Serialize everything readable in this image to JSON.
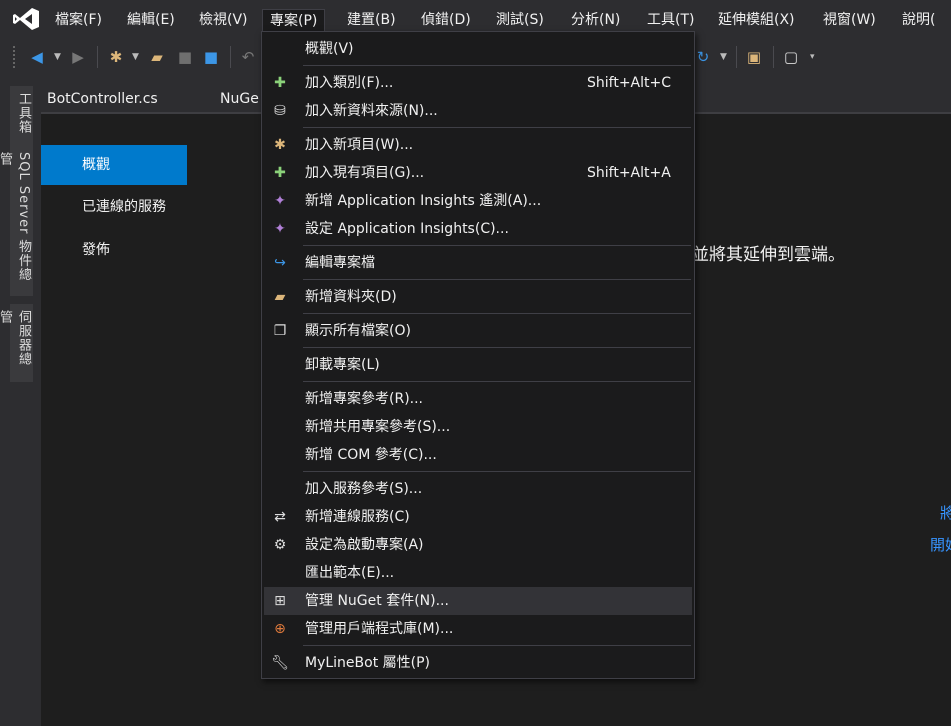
{
  "menubar": {
    "items": [
      "檔案(F)",
      "編輯(E)",
      "檢視(V)",
      "專案(P)",
      "建置(B)",
      "偵錯(D)",
      "測試(S)",
      "分析(N)",
      "工具(T)",
      "延伸模組(X)",
      "視窗(W)",
      "說明("
    ],
    "active_index": 3
  },
  "left_tool_windows": [
    "工具箱",
    "SQL Server 物件總管",
    "伺服器總管"
  ],
  "doc_tabs": [
    "BotController.cs",
    "NuGe"
  ],
  "project_nav": {
    "items": [
      "概觀",
      "已連線的服務",
      "發佈"
    ],
    "selected_index": 0
  },
  "content": {
    "partial_text": "並將其延伸到雲端。",
    "partial_links": [
      "將",
      "開始"
    ]
  },
  "project_menu": {
    "items": [
      {
        "label": "概觀(V)",
        "shortcut": "",
        "icon": ""
      },
      {
        "label": "加入類別(F)...",
        "shortcut": "Shift+Alt+C",
        "icon": "add-class-icon"
      },
      {
        "label": "加入新資料來源(N)...",
        "shortcut": "",
        "icon": "add-datasource-icon"
      },
      {
        "label": "加入新項目(W)...",
        "shortcut": "",
        "icon": "add-new-item-icon"
      },
      {
        "label": "加入現有項目(G)...",
        "shortcut": "Shift+Alt+A",
        "icon": "add-existing-item-icon"
      },
      {
        "label": "新增 Application Insights 遙測(A)...",
        "shortcut": "",
        "icon": "app-insights-icon"
      },
      {
        "label": "設定 Application Insights(C)...",
        "shortcut": "",
        "icon": "app-insights-icon"
      },
      {
        "label": "編輯專案檔",
        "shortcut": "",
        "icon": "edit-project-icon"
      },
      {
        "label": "新增資料夾(D)",
        "shortcut": "",
        "icon": "new-folder-icon"
      },
      {
        "label": "顯示所有檔案(O)",
        "shortcut": "",
        "icon": "show-all-files-icon"
      },
      {
        "label": "卸載專案(L)",
        "shortcut": "",
        "icon": ""
      },
      {
        "label": "新增專案參考(R)...",
        "shortcut": "",
        "icon": ""
      },
      {
        "label": "新增共用專案參考(S)...",
        "shortcut": "",
        "icon": ""
      },
      {
        "label": "新增 COM 參考(C)...",
        "shortcut": "",
        "icon": ""
      },
      {
        "label": "加入服務參考(S)...",
        "shortcut": "",
        "icon": ""
      },
      {
        "label": "新增連線服務(C)",
        "shortcut": "",
        "icon": "connected-service-icon"
      },
      {
        "label": "設定為啟動專案(A)",
        "shortcut": "",
        "icon": "gear-icon"
      },
      {
        "label": "匯出範本(E)...",
        "shortcut": "",
        "icon": ""
      },
      {
        "label": "管理 NuGet 套件(N)...",
        "shortcut": "",
        "icon": "nuget-package-icon"
      },
      {
        "label": "管理用戶端程式庫(M)...",
        "shortcut": "",
        "icon": "client-library-icon"
      },
      {
        "label": "MyLineBot 屬性(P)",
        "shortcut": "",
        "icon": "wrench-icon"
      }
    ],
    "hover_index": 18
  },
  "colors": {
    "accent": "#007acc",
    "menu_bg": "#1b1b1c",
    "chrome_bg": "#2d2d30",
    "link": "#3794ff"
  }
}
